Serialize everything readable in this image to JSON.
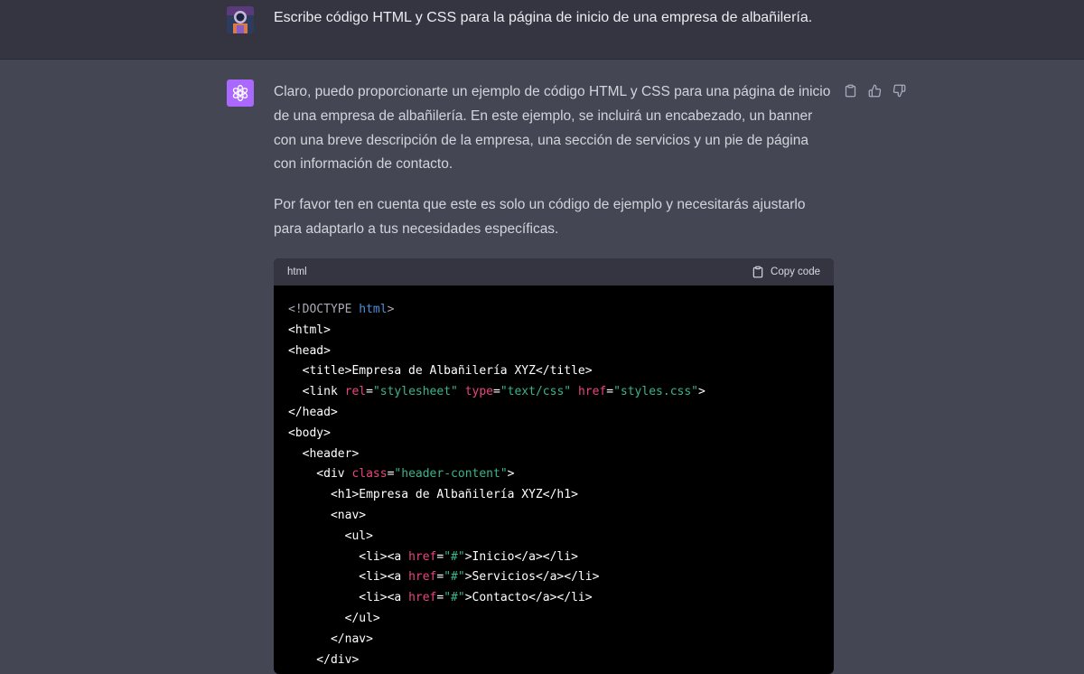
{
  "user": {
    "avatar": "user-avatar-image",
    "message": "Escribe código HTML y CSS para la página de inicio de una empresa de albañilería."
  },
  "assistant": {
    "avatar": "openai-logo-icon",
    "paragraphs": [
      "Claro, puedo proporcionarte un ejemplo de código HTML y CSS para una página de inicio de una empresa de albañilería. En este ejemplo, se incluirá un encabezado, un banner con una breve descripción de la empresa, una sección de servicios y un pie de página con información de contacto.",
      "Por favor ten en cuenta que este es solo un código de ejemplo y necesitarás ajustarlo para adaptarlo a tus necesidades específicas."
    ],
    "actions": [
      "clipboard-icon",
      "thumbs-up-icon",
      "thumbs-down-icon"
    ]
  },
  "code": {
    "language": "html",
    "copy_label": "Copy code",
    "lines": [
      [
        [
          "doc",
          "<!DOCTYPE "
        ],
        [
          "kw",
          "html"
        ],
        [
          "doc",
          ">"
        ]
      ],
      [
        [
          "t",
          "<html>"
        ]
      ],
      [
        [
          "t",
          "<head>"
        ]
      ],
      [
        [
          "t",
          "  <title>Empresa de Albañilería XYZ</title>"
        ]
      ],
      [
        [
          "t",
          "  <link "
        ],
        [
          "attr",
          "rel"
        ],
        [
          "t",
          "="
        ],
        [
          "str",
          "\"stylesheet\""
        ],
        [
          "t",
          " "
        ],
        [
          "attr",
          "type"
        ],
        [
          "t",
          "="
        ],
        [
          "str",
          "\"text/css\""
        ],
        [
          "t",
          " "
        ],
        [
          "attr",
          "href"
        ],
        [
          "t",
          "="
        ],
        [
          "str",
          "\"styles.css\""
        ],
        [
          "t",
          ">"
        ]
      ],
      [
        [
          "t",
          "</head>"
        ]
      ],
      [
        [
          "t",
          "<body>"
        ]
      ],
      [
        [
          "t",
          "  <header>"
        ]
      ],
      [
        [
          "t",
          "    <div "
        ],
        [
          "attr",
          "class"
        ],
        [
          "t",
          "="
        ],
        [
          "str",
          "\"header-content\""
        ],
        [
          "t",
          ">"
        ]
      ],
      [
        [
          "t",
          "      <h1>Empresa de Albañilería XYZ</h1>"
        ]
      ],
      [
        [
          "t",
          "      <nav>"
        ]
      ],
      [
        [
          "t",
          "        <ul>"
        ]
      ],
      [
        [
          "t",
          "          <li><a "
        ],
        [
          "attr",
          "href"
        ],
        [
          "t",
          "="
        ],
        [
          "str",
          "\"#\""
        ],
        [
          "t",
          ">Inicio</a></li>"
        ]
      ],
      [
        [
          "t",
          "          <li><a "
        ],
        [
          "attr",
          "href"
        ],
        [
          "t",
          "="
        ],
        [
          "str",
          "\"#\""
        ],
        [
          "t",
          ">Servicios</a></li>"
        ]
      ],
      [
        [
          "t",
          "          <li><a "
        ],
        [
          "attr",
          "href"
        ],
        [
          "t",
          "="
        ],
        [
          "str",
          "\"#\""
        ],
        [
          "t",
          ">Contacto</a></li>"
        ]
      ],
      [
        [
          "t",
          "        </ul>"
        ]
      ],
      [
        [
          "t",
          "      </nav>"
        ]
      ],
      [
        [
          "t",
          "    </div>"
        ]
      ]
    ]
  }
}
